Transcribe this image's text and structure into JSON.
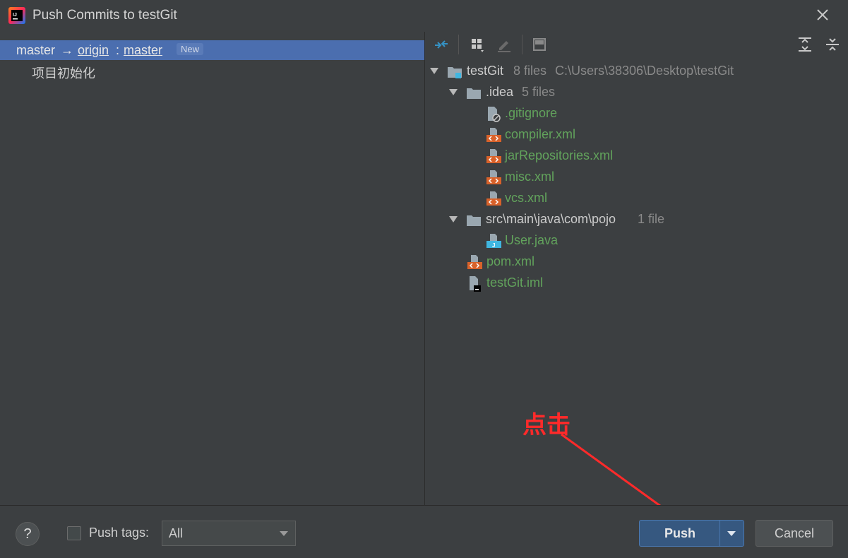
{
  "window": {
    "title": "Push Commits to testGit",
    "app_icon": "intellij-idea-icon",
    "close_icon": "close-icon"
  },
  "push_tree": {
    "branch": {
      "local": "master",
      "arrow": "→",
      "remote": "origin",
      "separator": ":",
      "remote_branch": "master",
      "badge": "New"
    },
    "commits": [
      {
        "message": "项目初始化"
      }
    ]
  },
  "toolbar": {
    "icons": [
      "show-diff-icon",
      "group-by-icon",
      "edit-icon",
      "preview-icon",
      "expand-all-icon",
      "collapse-all-icon"
    ]
  },
  "changes_tree": {
    "root": {
      "name": "testGit",
      "count": "8 files",
      "path": "C:\\Users\\38306\\Desktop\\testGit"
    },
    "folders": [
      {
        "name": ".idea",
        "count": "5 files",
        "files": [
          ".gitignore",
          "compiler.xml",
          "jarRepositories.xml",
          "misc.xml",
          "vcs.xml"
        ]
      },
      {
        "name": "src\\main\\java\\com\\pojo",
        "count": "1 file",
        "files": [
          "User.java"
        ]
      }
    ],
    "root_files": [
      "pom.xml",
      "testGit.iml"
    ]
  },
  "annotation": {
    "text": "点击",
    "color": "#ff2a2a"
  },
  "footer": {
    "help_label": "?",
    "push_tags_label": "Push tags:",
    "push_tags_checked": false,
    "tags_select_value": "All",
    "push_button": "Push",
    "cancel_button": "Cancel"
  },
  "colors": {
    "accent": "#4b6eaf",
    "file_added": "#62a35c",
    "background": "#3c3f41"
  }
}
